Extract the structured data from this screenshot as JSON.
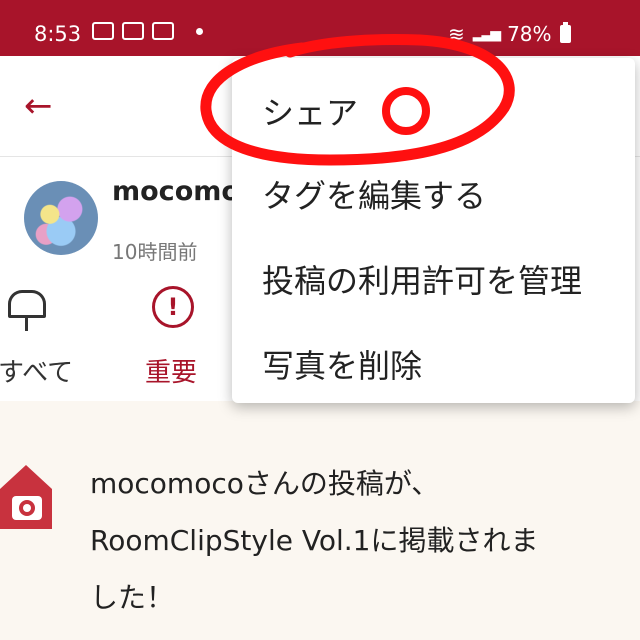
{
  "status_bar": {
    "time": "8:53",
    "battery": "78%"
  },
  "profile": {
    "username": "mocomoc",
    "time_ago": "10時間前"
  },
  "tabs": [
    {
      "label": "すべて"
    },
    {
      "label": "重要",
      "icon": "!"
    }
  ],
  "notification": {
    "lines": [
      "mocomocoさんの投稿が、",
      "RoomClipStyle Vol.1に掲載されま",
      "した！"
    ]
  },
  "menu": {
    "items": [
      "シェア",
      "タグを編集する",
      "投稿の利用許可を管理",
      "写真を削除"
    ]
  },
  "colors": {
    "brand": "#a8142a",
    "annotation": "#ff0000"
  },
  "icons": [
    "back-arrow-icon",
    "mailbox-icon",
    "alert-icon",
    "house-camera-icon",
    "wifi-icon",
    "battery-icon"
  ]
}
